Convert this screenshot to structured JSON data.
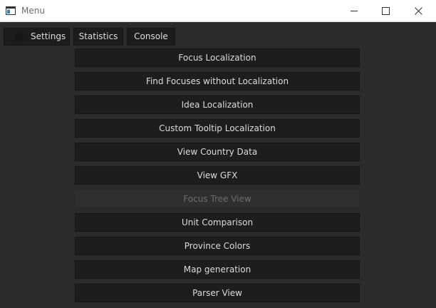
{
  "window": {
    "title": "Menu",
    "icon": "app-window-icon",
    "controls": [
      "minimize-icon",
      "maximize-icon",
      "close-icon"
    ]
  },
  "toolbar": {
    "settings": {
      "label": "Settings",
      "icon": "gear-icon"
    },
    "statistics": {
      "label": "Statistics"
    },
    "console": {
      "label": "Console"
    }
  },
  "menu": {
    "items": [
      {
        "label": "Focus Localization",
        "enabled": true
      },
      {
        "label": "Find Focuses without Localization",
        "enabled": true
      },
      {
        "label": "Idea Localization",
        "enabled": true
      },
      {
        "label": "Custom Tooltip Localization",
        "enabled": true
      },
      {
        "label": "View Country Data",
        "enabled": true
      },
      {
        "label": "View GFX",
        "enabled": true
      },
      {
        "label": "Focus Tree View",
        "enabled": false
      },
      {
        "label": "Unit Comparison",
        "enabled": true
      },
      {
        "label": "Province Colors",
        "enabled": true
      },
      {
        "label": "Map generation",
        "enabled": true
      },
      {
        "label": "Parser View",
        "enabled": true
      }
    ]
  },
  "colors": {
    "background": "#2b2b2b",
    "button": "#1d1d1d",
    "button_disabled": "#2f2f2f",
    "text": "#dcdcdc",
    "text_disabled": "#6f6f6f",
    "titlebar": "#ffffff"
  }
}
